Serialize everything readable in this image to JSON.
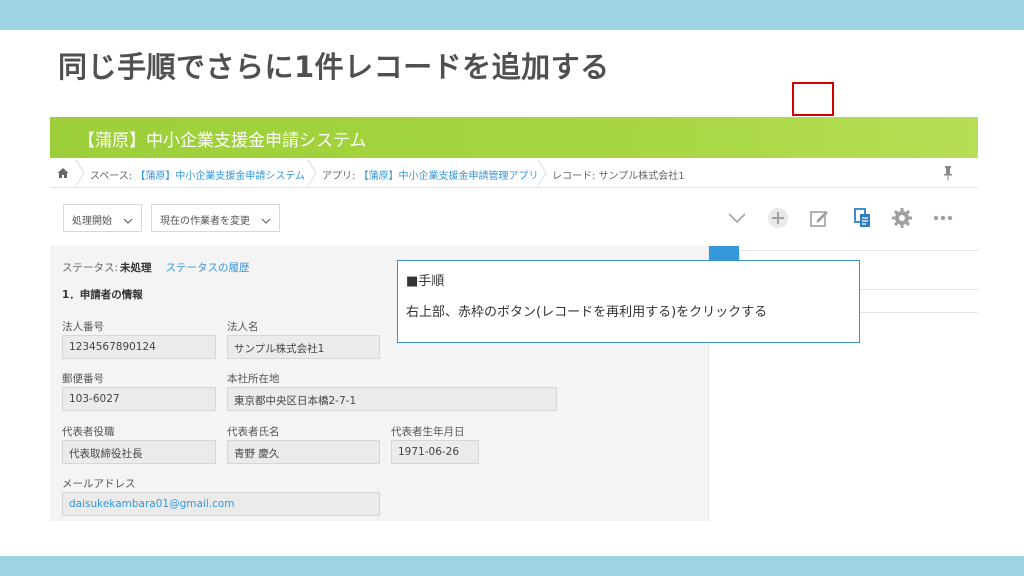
{
  "slide": {
    "title": "同じ手順でさらに1件レコードを追加する"
  },
  "app": {
    "title": "【蒲原】中小企業支援金申請システム",
    "header_color": "#a6d640",
    "accent_color": "#3498db"
  },
  "breadcrumb": {
    "home_icon": "home-icon",
    "space_prefix": "スペース:",
    "space_name": "【蒲原】中小企業支援金申請システム",
    "app_prefix": "アプリ:",
    "app_name": "【蒲原】中小企業支援金申請管理アプリ",
    "record_prefix": "レコード:",
    "record_name": "サンプル株式会社1"
  },
  "toolbar": {
    "process_start_label": "処理開始",
    "change_assignee_label": "現在の作業者を変更",
    "icons": [
      "chevron-down-icon",
      "add-icon",
      "edit-icon",
      "reuse-record-icon",
      "gear-icon",
      "more-icon"
    ],
    "highlight_color": "#d40000"
  },
  "record": {
    "status_label": "ステータス:",
    "status_value": "未処理",
    "status_history_link": "ステータスの履歴",
    "section_title": "1．申請者の情報",
    "fields": {
      "corp_number": {
        "label": "法人番号",
        "value": "1234567890124"
      },
      "corp_name": {
        "label": "法人名",
        "value": "サンプル株式会社1"
      },
      "postal_code": {
        "label": "郵便番号",
        "value": "103-6027"
      },
      "address": {
        "label": "本社所在地",
        "value": "東京都中央区日本橋2-7-1"
      },
      "rep_title": {
        "label": "代表者役職",
        "value": "代表取締役社長"
      },
      "rep_name": {
        "label": "代表者氏名",
        "value": "青野 慶久"
      },
      "rep_birthday": {
        "label": "代表者生年月日",
        "value": "1971-06-26"
      },
      "email": {
        "label": "メールアドレス",
        "value": "daisukekambara01@gmail.com"
      }
    }
  },
  "callout": {
    "title": "■手順",
    "body": "右上部、赤枠のボタン(レコードを再利用する)をクリックする"
  }
}
